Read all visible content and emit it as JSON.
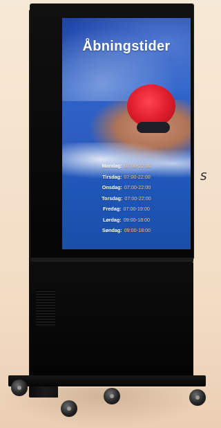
{
  "screen": {
    "title": "Åbningstider",
    "hours": [
      {
        "day": "Mandag:",
        "time": "07:00-22:00"
      },
      {
        "day": "Tirsdag:",
        "time": "07:00-22:00"
      },
      {
        "day": "Onsdag:",
        "time": "07:00-22:00"
      },
      {
        "day": "Torsdag:",
        "time": "07:00-22:00"
      },
      {
        "day": "Fredag:",
        "time": "07:00-19:00"
      },
      {
        "day": "Lørdag:",
        "time": "09:00-18:00"
      },
      {
        "day": "Søndag:",
        "time": "09:00-18:00"
      }
    ]
  },
  "side_caption": "S",
  "colors": {
    "background": "#f2dcc4",
    "cabinet": "#0b0b0b",
    "screen_blue": "#2e63c9",
    "cap_red": "#e01e2c",
    "time_orange": "#ffc392"
  }
}
